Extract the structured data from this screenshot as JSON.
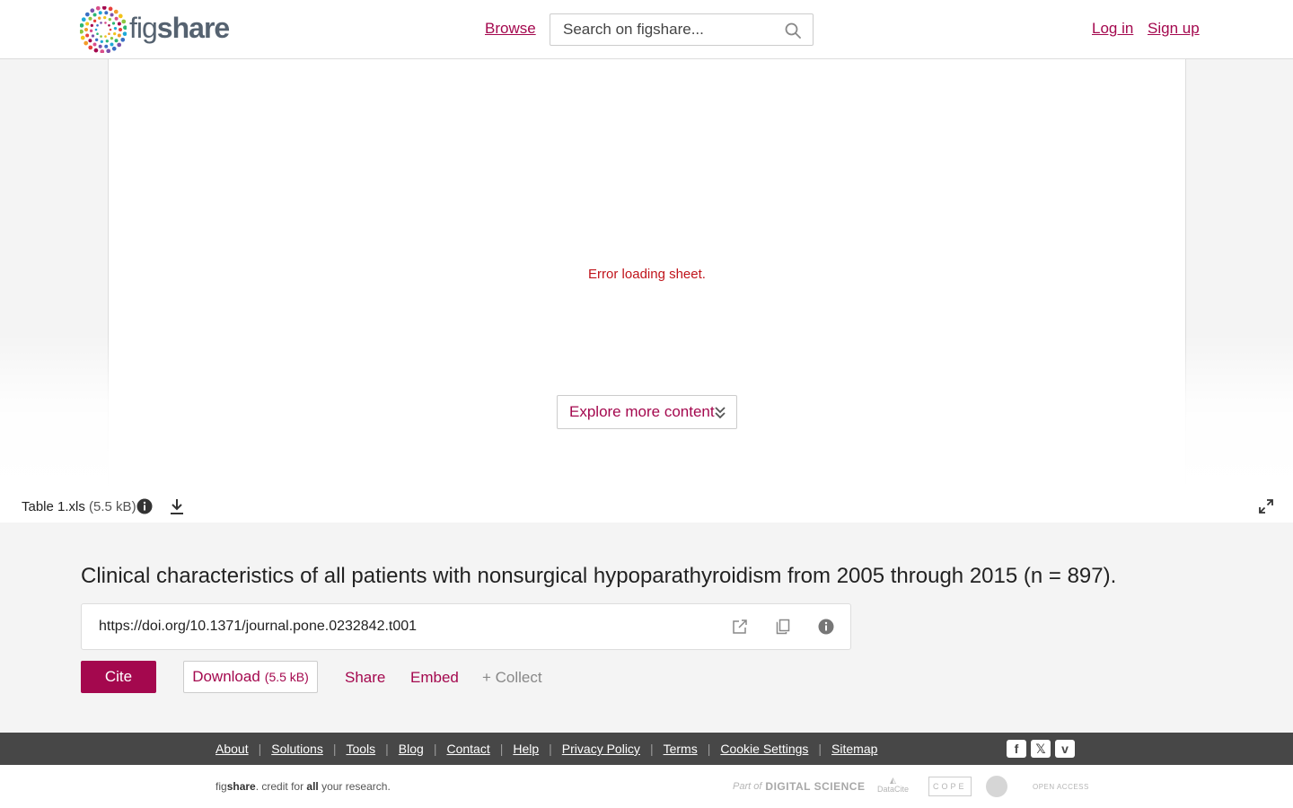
{
  "header": {
    "logo_fig": "fig",
    "logo_share": "share",
    "browse": "Browse",
    "search_placeholder": "Search on figshare...",
    "login": "Log in",
    "signup": "Sign up"
  },
  "viewer": {
    "error": "Error loading sheet.",
    "explore": "Explore more content"
  },
  "file": {
    "name": "Table 1.xls",
    "size": "(5.5 kB)"
  },
  "item": {
    "title": "Clinical characteristics of all patients with nonsurgical hypoparathyroidism from 2005 through 2015 (n = 897).",
    "doi": "https://doi.org/10.1371/journal.pone.0232842.t001",
    "cite": "Cite",
    "download": "Download",
    "download_size": "(5.5 kB)",
    "share": "Share",
    "embed": "Embed",
    "collect": "+ Collect"
  },
  "footer": {
    "links": [
      "About",
      "Solutions",
      "Tools",
      "Blog",
      "Contact",
      "Help",
      "Privacy Policy",
      "Terms",
      "Cookie Settings",
      "Sitemap"
    ],
    "tagline_fig": "fig",
    "tagline_share": "share",
    "tagline_mid": ". credit for ",
    "tagline_all": "all",
    "tagline_end": " your research.",
    "partner_partof": "Part of",
    "partner_ds": "DIGITAL SCIENCE",
    "partner_datacite": "DataCite",
    "partner_cope": "COPE",
    "partner_oa": "OPEN ACCESS"
  },
  "colors": {
    "brand": "#a4084e",
    "error": "#c0141b",
    "footer_bg": "#474747"
  }
}
